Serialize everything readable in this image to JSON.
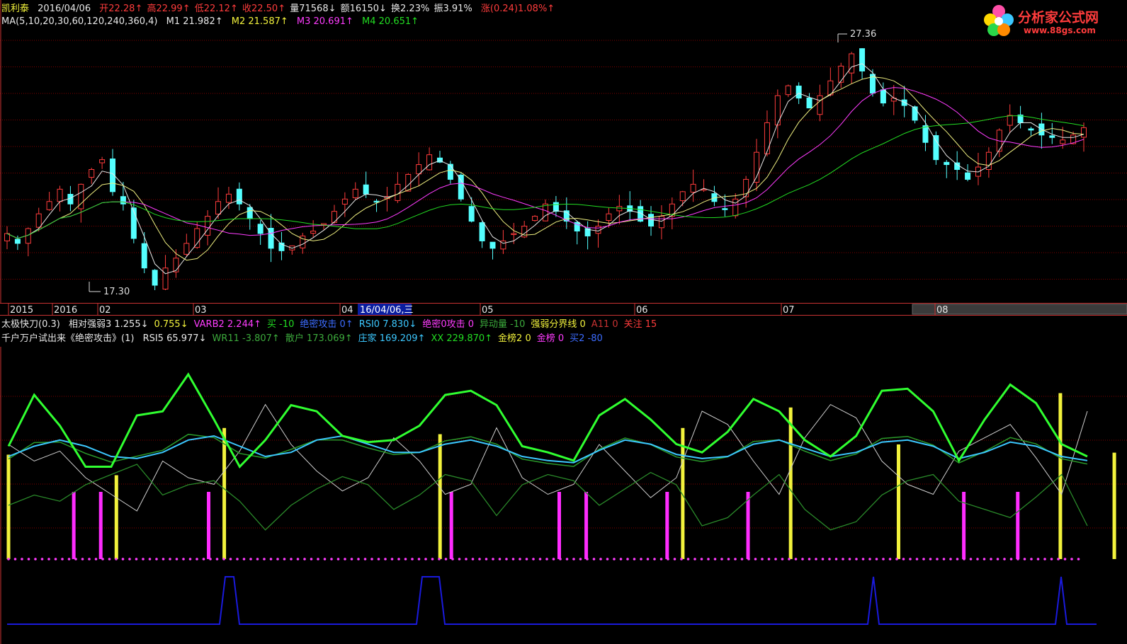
{
  "header": {
    "stock_name": "凯利泰",
    "date": "2016/04/06",
    "open": "开22.28↑",
    "high": "高22.99↑",
    "low": "低22.12↑",
    "close": "收22.50↑",
    "volume": "量71568↓",
    "amount": "额16150↓",
    "turnover": "换2.23%",
    "amplitude": "振3.91%",
    "change": "涨(0.24)1.08%↑"
  },
  "ma_row": {
    "label": "MA(5,10,20,30,60,120,240,360,4)",
    "m1": "M1 21.982↑",
    "m2": "M2 21.587↑",
    "m3": "M3 20.691↑",
    "m4": "M4 20.651↑"
  },
  "logo": {
    "title": "分析家公式网",
    "url": "www.88gs.com"
  },
  "price_annotations": {
    "high_label": "27.36",
    "low_label": "17.30"
  },
  "time_axis": {
    "labels": [
      "2015",
      "2016",
      "02",
      "03",
      "04",
      "05",
      "06",
      "07",
      "08"
    ],
    "cursor_label": "16/04/06,三"
  },
  "indicator_row1": {
    "title": "太极快刀(0.3)",
    "items": [
      {
        "text": "相对强弱3 1.255↓",
        "color": "#e8e8e8"
      },
      {
        "text": "0.755↓",
        "color": "#f2f23c"
      },
      {
        "text": "VARB2 2.244↑",
        "color": "#ff3cff"
      },
      {
        "text": "买 -10",
        "color": "#22dd22"
      },
      {
        "text": "绝密攻击 0↑",
        "color": "#3c6cff"
      },
      {
        "text": "RSI0 7.830↓",
        "color": "#3cc8ff"
      },
      {
        "text": "绝密0攻击 0",
        "color": "#ff3cff"
      },
      {
        "text": "异动量 -10",
        "color": "#3caa3c"
      },
      {
        "text": "强弱分界线 0",
        "color": "#f2f23c"
      },
      {
        "text": "A11 0",
        "color": "#c83232"
      },
      {
        "text": "关注 15",
        "color": "#ff3c3c"
      }
    ]
  },
  "indicator_row2": {
    "title": "千户万户试出来《绝密攻击》(1)",
    "items": [
      {
        "text": "RSI5 65.977↓",
        "color": "#e8e8e8"
      },
      {
        "text": "WR11 -3.807↑",
        "color": "#3caa3c"
      },
      {
        "text": "散户 173.069↑",
        "color": "#3caa3c"
      },
      {
        "text": "庄家 169.209↑",
        "color": "#3cc8ff"
      },
      {
        "text": "XX 229.870↑",
        "color": "#22dd22"
      },
      {
        "text": "金榜2 0",
        "color": "#f2f23c"
      },
      {
        "text": "金榜 0",
        "color": "#ff3cff"
      },
      {
        "text": "买2 -80",
        "color": "#3c6cff"
      }
    ]
  },
  "colors": {
    "up": "#ff3c3c",
    "down": "#54ffff",
    "grid": "#800000",
    "ma1": "#e8e8e8",
    "ma2": "#f0f080",
    "ma3": "#ff3cff",
    "ma4": "#22dd22"
  },
  "chart_data": [
    {
      "type": "candlestick",
      "title": "凯利泰",
      "ylim": [
        17.3,
        27.36
      ],
      "high": 27.36,
      "low": 17.3,
      "closes": [
        19.6,
        19.2,
        19.8,
        20.4,
        20.9,
        21.4,
        20.8,
        21.6,
        22.2,
        22.6,
        21.3,
        20.8,
        19.4,
        18.2,
        17.5,
        18.2,
        18.6,
        19.2,
        19.8,
        20.3,
        20.9,
        21.2,
        20.8,
        20.2,
        19.6,
        19.0,
        18.9,
        19.1,
        19.5,
        19.7,
        20.0,
        20.5,
        21.0,
        21.4,
        21.2,
        20.9,
        21.1,
        21.6,
        22.0,
        22.4,
        22.8,
        22.5,
        21.8,
        21.0,
        20.1,
        19.3,
        19.0,
        19.3,
        19.6,
        19.9,
        20.3,
        20.8,
        20.5,
        20.1,
        19.7,
        19.5,
        19.9,
        20.4,
        20.7,
        20.5,
        20.1,
        19.9,
        20.3,
        20.8,
        21.3,
        21.6,
        21.4,
        20.9,
        20.6,
        21.0,
        21.8,
        22.9,
        24.1,
        25.2,
        25.6,
        25.1,
        24.7,
        25.2,
        25.8,
        26.4,
        26.9,
        26.2,
        25.3,
        24.9,
        25.1,
        24.8,
        24.2,
        23.3,
        22.6,
        22.4,
        22.2,
        21.8,
        22.3,
        22.9,
        23.8,
        24.4,
        24.1,
        23.8,
        23.6,
        23.5,
        23.4,
        23.6,
        23.9
      ]
    },
    {
      "type": "line",
      "title": "太极快刀(0.3)",
      "series": [
        {
          "name": "XX",
          "values": [
            55,
            80,
            65,
            45,
            45,
            70,
            72,
            90,
            68,
            45,
            58,
            75,
            72,
            60,
            57,
            58,
            65,
            80,
            82,
            75,
            55,
            52,
            48,
            70,
            78,
            68,
            56,
            52,
            62,
            78,
            72,
            58,
            50,
            60,
            82,
            83,
            72,
            48,
            68,
            85,
            76,
            56,
            50
          ]
        },
        {
          "name": "庄家",
          "values": [
            50,
            55,
            58,
            55,
            50,
            49,
            52,
            58,
            60,
            55,
            50,
            52,
            58,
            60,
            56,
            52,
            52,
            56,
            58,
            55,
            50,
            48,
            47,
            53,
            58,
            56,
            51,
            49,
            50,
            56,
            58,
            54,
            50,
            52,
            57,
            58,
            55,
            49,
            52,
            57,
            55,
            50,
            48
          ]
        },
        {
          "name": "RSI5",
          "values": [
            60,
            55,
            58,
            50,
            45,
            40,
            55,
            50,
            48,
            58,
            72,
            60,
            52,
            46,
            50,
            62,
            55,
            45,
            48,
            65,
            50,
            45,
            48,
            60,
            52,
            44,
            50,
            70,
            66,
            55,
            45,
            62,
            72,
            68,
            55,
            48,
            45,
            58,
            62,
            66,
            56,
            45,
            70
          ]
        }
      ]
    }
  ]
}
